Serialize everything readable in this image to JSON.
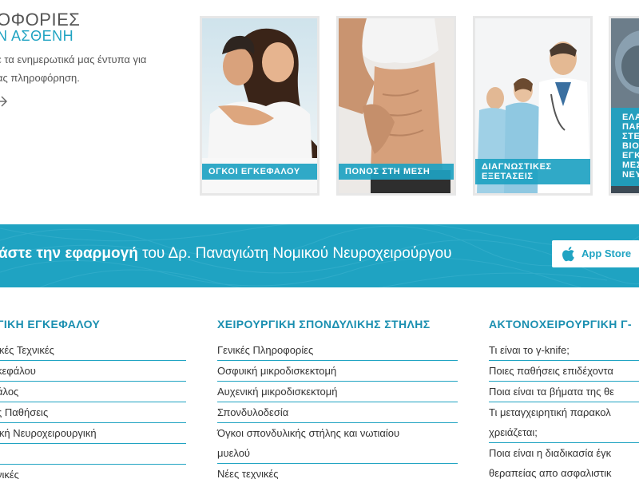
{
  "info": {
    "title_1": "ΟΦΟΡΙΕΣ",
    "title_2": "Ν ΑΣΘΕΝΗ",
    "text_1": "ε τα ενημερωτικά μας έντυπα για",
    "text_2": "ας πληροφόρηση."
  },
  "cards": [
    {
      "label": "ΟΓΚΟΙ ΕΓΚΕΦΑΛΟΥ"
    },
    {
      "label": "ΠΟΝΟΣ ΣΤΗ ΜΕΣΗ"
    },
    {
      "label_1": "ΔΙΑΓΝΩΣΤΙΚΕΣ",
      "label_2": "ΕΞΕΤΑΣΕΙΣ"
    },
    {
      "lines": [
        "ΕΛΑ",
        "ΠΑΡ",
        "ΣΤΕ",
        "ΒΙΟ",
        "ΕΓΚ",
        "ΜΕΣ",
        "ΝΕΥ"
      ]
    }
  ],
  "app_band": {
    "bold_text": "άστε την εφαρμογή",
    "normal_text": " του Δρ. Παναγιώτη Νομικού Νευροχειρούργου",
    "button_label": "App Store"
  },
  "columns": [
    {
      "heading": "ΓΙΚΗ ΕΓΚΕΦΑΛΟΥ",
      "items": [
        "ικές Τεχνικές",
        "κεφάλου",
        "άλος",
        "ς Παθήσεις",
        "ική Νευροχειρουργική",
        "",
        "νικές"
      ]
    },
    {
      "heading": "ΧΕΙΡΟΥΡΓΙΚΗ ΣΠΟΝΔΥΛΙΚΗΣ ΣΤΗΛΗΣ",
      "items": [
        "Γενικές Πληροφορίες",
        "Οσφυική μικροδισκεκτομή",
        "Αυχενική μικροδισκεκτομή",
        "Σπονδυλοδεσία"
      ],
      "multiline_item": {
        "line_1": "Όγκοι σπονδυλικής στήλης και νωτιαίου",
        "line_2": "μυελού"
      },
      "last_item": "Νέες τεχνικές"
    },
    {
      "heading": "ΑΚΤΟΝΟΧΕΙΡΟΥΡΓΙΚΗ Γ-",
      "items": [
        "Τι είναι το γ-knife;",
        "Ποιες παθήσεις επιδέχοντα",
        "Ποια είναι τα βήματα της θε"
      ],
      "multiline_item_1": {
        "line_1": "Τι μεταγχειρητική παρακολ",
        "line_2": "χρειάζεται;"
      },
      "multiline_item_2": {
        "line_1": "Ποια είναι η διαδικασία έγκ",
        "line_2": "θεραπείας απο ασφαλιστικ"
      }
    }
  ],
  "colors": {
    "accent": "#1fa3c2",
    "heading": "#1a8fb0"
  }
}
